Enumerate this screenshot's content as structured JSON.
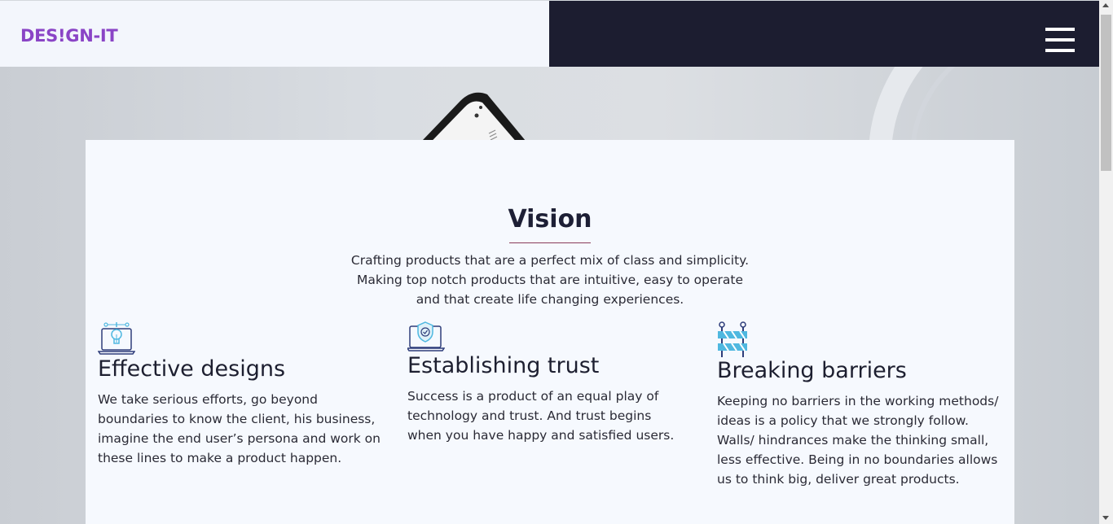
{
  "header": {
    "logo": "DES!GN-IT",
    "menu_icon": "hamburger-menu-icon"
  },
  "vision": {
    "title": "Vision",
    "text": "Crafting products that are a perfect mix of class and simplicity. Making top notch products that are intuitive, easy to operate and that create life changing experiences."
  },
  "features": [
    {
      "icon": "lightbulb-laptop-icon",
      "title": "Effective designs",
      "text": "We take serious efforts, go beyond boundaries to know the client, his business, imagine the end user’s persona and work on these lines to make a product happen."
    },
    {
      "icon": "shield-laptop-icon",
      "title": "Establishing trust",
      "text": "Success is a product of an equal play of technology and trust. And trust begins when you have happy and satisfied users."
    },
    {
      "icon": "barrier-icon",
      "title": "Breaking barriers",
      "text": "Keeping no barriers in the working methods/ ideas is a policy that we strongly follow. Walls/ hindrances make the thinking small, less effective. Being in no boundaries allows us to think big, deliver great products."
    }
  ],
  "colors": {
    "logo": "#8a44c6",
    "header_dark": "#1c1d30",
    "header_light": "#f3f6fc",
    "card": "#f6f9fe",
    "accent_rule": "#8a3a5a",
    "icon_blue": "#4fb8e0",
    "icon_navy": "#2e3d7a"
  }
}
